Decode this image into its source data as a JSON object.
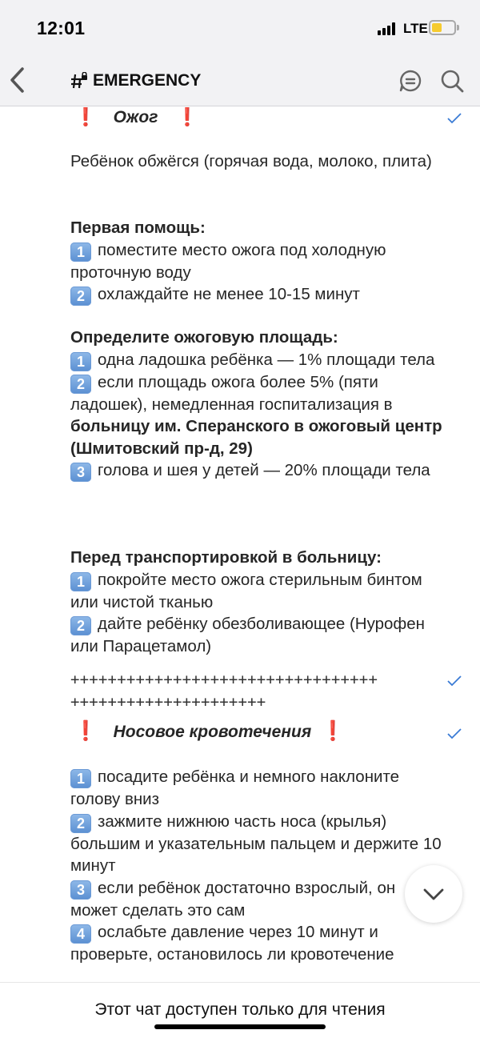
{
  "status_bar": {
    "time": "12:01",
    "network": "LTE",
    "battery_color": "#f6cb2f"
  },
  "nav": {
    "channel_name": "EMERGENCY",
    "back_icon": "chevron-left-icon",
    "info_icon": "chat-info-icon",
    "search_icon": "search-icon"
  },
  "message1": {
    "excl": "❗",
    "title": "Ожог",
    "intro": "Ребёнок обжёгся (горячая вода, молоко, плита)",
    "first_aid_heading": "Первая помощь:",
    "first_aid": [
      {
        "n": "1",
        "text": "поместите место ожога под холодную проточную воду"
      },
      {
        "n": "2",
        "text": "охлаждайте не менее 10-15 минут"
      }
    ],
    "area_heading": "Определите ожоговую площадь:",
    "area_1_n": "1",
    "area_1": "одна ладошка ребёнка — 1% площади тела",
    "area_2_n": "2",
    "area_2": "если площадь ожога более 5% (пяти ладошек), немедленная госпитализация в",
    "area_2_bold": "больницу им. Сперанского в ожоговый центр (Шмитовский пр-д, 29)",
    "area_3_n": "3",
    "area_3": "голова и шея у детей — 20% площади тела",
    "transport_heading": "Перед транспортировкой в больницу:",
    "transport": [
      {
        "n": "1",
        "text": "покройте место ожога стерильным бинтом или чистой тканью"
      },
      {
        "n": "2",
        "text": "дайте ребёнку обезболивающее (Нурофен или Парацетамол)"
      }
    ]
  },
  "separator": {
    "line1": "+++++++++++++++++++++++++++++++++",
    "line2": "+++++++++++++++++++++"
  },
  "message2": {
    "excl": "❗",
    "title": "Носовое кровотечения",
    "steps": [
      {
        "n": "1",
        "text": "посадите ребёнка и немного наклоните голову вниз"
      },
      {
        "n": "2",
        "text": "зажмите нижнюю часть носа (крылья) большим и указательным пальцем и держите 10 минут"
      },
      {
        "n": "3",
        "text": "если ребёнок достаточно взрослый, он может сделать это сам"
      },
      {
        "n": "4",
        "text": "ослабьте давление через 10 минут и проверьте, остановилось ли кровотечение"
      }
    ]
  },
  "footer": {
    "readonly_text": "Этот чат доступен только для чтения"
  },
  "colors": {
    "accent": "#3a7bd5",
    "nav_bg": "#f2f2f4",
    "alert": "#e0162b"
  }
}
